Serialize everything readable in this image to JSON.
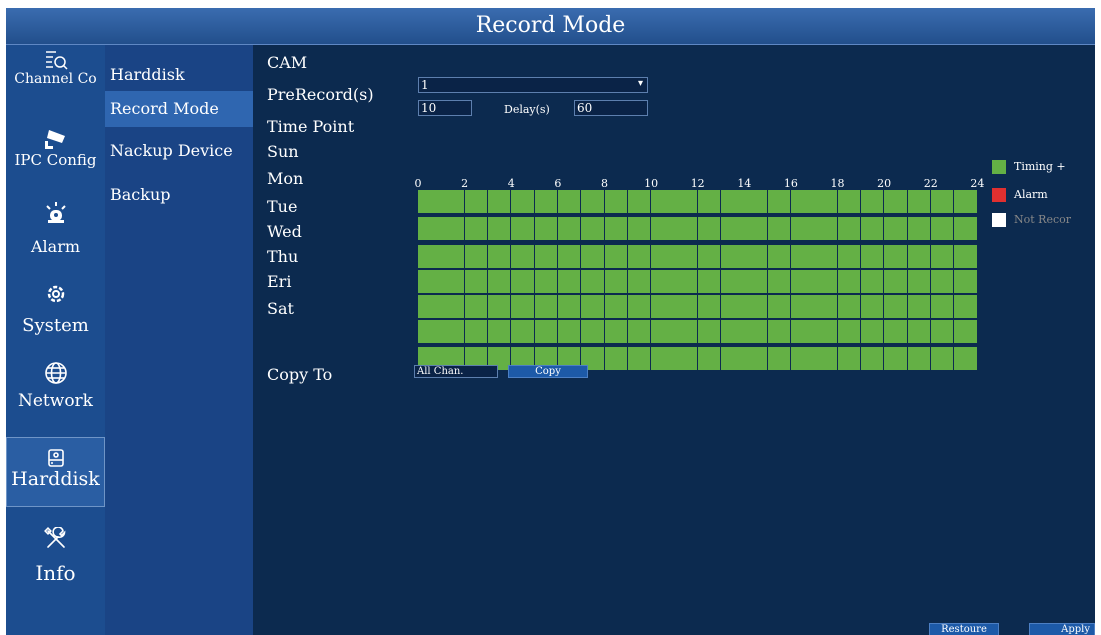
{
  "title": "Record Mode",
  "sidebar": {
    "items": [
      {
        "label": "Channel Co",
        "icon": "channel-config-icon"
      },
      {
        "label": "IPC Config",
        "icon": "camera-icon"
      },
      {
        "label": "Alarm",
        "icon": "alarm-icon"
      },
      {
        "label": "System",
        "icon": "gear-icon"
      },
      {
        "label": "Network",
        "icon": "globe-icon"
      },
      {
        "label": "Harddisk",
        "icon": "harddisk-icon",
        "active": true
      },
      {
        "label": "Info",
        "icon": "tools-icon"
      }
    ]
  },
  "submenu": {
    "items": [
      {
        "label": "Harddisk"
      },
      {
        "label": "Record Mode",
        "active": true
      },
      {
        "label": "Nackup Device"
      },
      {
        "label": "Backup"
      }
    ]
  },
  "form": {
    "cam_label": "CAM",
    "cam_value": "1",
    "prerecord_label": "PreRecord(s)",
    "prerecord_value": "10",
    "delay_label": "Delay(s)",
    "delay_value": "60",
    "timepoint_label": "Time Point",
    "copyto_label": "Copy To",
    "copy_source": "All Chan.",
    "copy_button": "Copy"
  },
  "schedule": {
    "hour_labels": [
      "0",
      "2",
      "4",
      "6",
      "8",
      "10",
      "12",
      "14",
      "16",
      "18",
      "20",
      "22",
      "24"
    ],
    "days": [
      "Sun",
      "Mon",
      "Tue",
      "Wed",
      "Thu",
      "Eri",
      "Sat"
    ],
    "slots_per_day": 24,
    "slot_mode": "timing"
  },
  "legend": [
    {
      "label": "Timing +",
      "color": "#64b045"
    },
    {
      "label": "Alarm",
      "color": "#e03030"
    },
    {
      "label": "Not Recor",
      "color": "#ffffff"
    }
  ],
  "footer": {
    "restore_label": "Restoure",
    "apply_label": "Apply"
  }
}
